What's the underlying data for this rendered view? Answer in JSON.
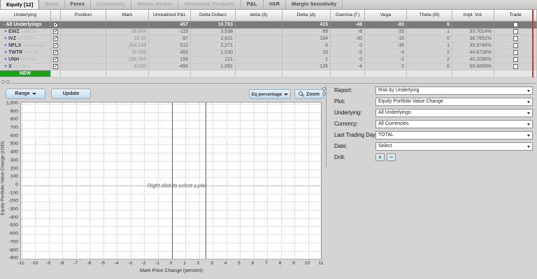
{
  "tabs": [
    {
      "label": "Equity [12]",
      "state": "active"
    },
    {
      "label": "Bond",
      "state": "disabled"
    },
    {
      "label": "Forex",
      "state": "normal"
    },
    {
      "label": "Commodity",
      "state": "disabled"
    },
    {
      "label": "Money Market",
      "state": "disabled"
    },
    {
      "label": "Structured Products",
      "state": "disabled"
    },
    {
      "label": "P&L",
      "state": "normal"
    },
    {
      "label": "VAR",
      "state": "normal"
    },
    {
      "label": "Margin Sensitivity",
      "state": "normal"
    }
  ],
  "table": {
    "columns": [
      "Underlying",
      "",
      "Position",
      "Mark",
      "Unrealized P&L",
      "Delta Dollars",
      "delta (δ)",
      "Delta (Δ)",
      "Gamma (Γ)",
      "Vega",
      "Theta (Θ)",
      "Impl. Vol.",
      "Trade"
    ],
    "total_row": {
      "label": "All Underlyings",
      "collapse_glyph": "-",
      "checked": true,
      "position": "",
      "mark": "",
      "unrealized_pnl": "457",
      "delta_dollars": "10,783",
      "delta_small": "",
      "delta": "415",
      "gamma": "-48",
      "vega": "-83",
      "theta": "6",
      "impl_vol": "",
      "trade_checked": false
    },
    "rows": [
      {
        "expand_glyph": "+",
        "symbol": "EWZ",
        "exchange": "<ARCA>",
        "checked": true,
        "position": "",
        "mark": "39.954",
        "unrealized_pnl": "-119",
        "delta_dollars": "3,538",
        "delta_small": "",
        "delta": "89",
        "gamma": "-8",
        "vega": "-20",
        "theta": "1",
        "impl_vol": "33.7014%",
        "trade_checked": false
      },
      {
        "expand_glyph": "+",
        "symbol": "IVZ",
        "exchange": "<NYSE>",
        "checked": true,
        "position": "",
        "mark": "16.02",
        "unrealized_pnl": "-97",
        "delta_dollars": "2,631",
        "delta_small": "",
        "delta": "164",
        "gamma": "-30",
        "vega": "-16",
        "theta": "0",
        "impl_vol": "38.7651%",
        "trade_checked": false
      },
      {
        "expand_glyph": "+",
        "symbol": "NFLX",
        "exchange": "<NASDAQ>",
        "checked": true,
        "position": "",
        "mark": "364.168",
        "unrealized_pnl": "512",
        "delta_dollars": "2,271",
        "delta_small": "",
        "delta": "6",
        "gamma": "0",
        "vega": "-36",
        "theta": "1",
        "impl_vol": "39.9748%",
        "trade_checked": false
      },
      {
        "expand_glyph": "+",
        "symbol": "TWTR",
        "exchange": "<NYSE>",
        "checked": true,
        "position": "",
        "mark": "35.599",
        "unrealized_pnl": "455",
        "delta_dollars": "1,030",
        "delta_small": "",
        "delta": "29",
        "gamma": "-5",
        "vega": "-9",
        "theta": "2",
        "impl_vol": "44.8738%",
        "trade_checked": false
      },
      {
        "expand_glyph": "+",
        "symbol": "UNH",
        "exchange": "<NYSE>",
        "checked": true,
        "position": "",
        "mark": "266.365",
        "unrealized_pnl": "198",
        "delta_dollars": "221",
        "delta_small": "",
        "delta": "1",
        "gamma": "0",
        "vega": "-2",
        "theta": "2",
        "impl_vol": "40.2098%",
        "trade_checked": false
      },
      {
        "expand_glyph": "+",
        "symbol": "X",
        "exchange": "<NYSE>",
        "checked": true,
        "position": "",
        "mark": "8.636",
        "unrealized_pnl": "-490",
        "delta_dollars": "1,091",
        "delta_small": "",
        "delta": "126",
        "gamma": "-4",
        "vega": "0",
        "theta": "0",
        "impl_vol": "69.6899%",
        "trade_checked": false
      }
    ],
    "new_row_label": "NEW"
  },
  "toolbar": {
    "range_label": "Range",
    "update_label": "Update",
    "eq_percentage_label": "Eq percentage",
    "zoom_label": "Zoom"
  },
  "chart_data": {
    "type": "line",
    "title": "",
    "xlabel": "Mark Price Change (percent)",
    "ylabel": "Equity Portfolio Value Change (USD)",
    "xlim": [
      -11.05,
      11.05
    ],
    "ylim": [
      -915,
      1017
    ],
    "x_ticks": [
      -11,
      -10,
      -9,
      -8,
      -7,
      -6,
      -5,
      -4,
      -3,
      -2,
      -1,
      0,
      1,
      2,
      3,
      4,
      5,
      6,
      7,
      8,
      9,
      10,
      11
    ],
    "y_ticks": [
      1000,
      900,
      800,
      700,
      600,
      500,
      400,
      300,
      200,
      100,
      0,
      -100,
      -200,
      -300,
      -400,
      -500,
      -600,
      -700,
      -800,
      -900
    ],
    "grid": "dotted",
    "legend": "none",
    "series": [],
    "placeholder_text": "Right click to select a plot",
    "reference_lines_x": [
      0,
      2.5
    ],
    "zero_line_y": 0
  },
  "panel": {
    "fields": [
      {
        "label": "Report:",
        "value": "Risk by Underlying"
      },
      {
        "label": "Plot:",
        "value": "Equity Portfolio Value Change"
      },
      {
        "label": "Underlying:",
        "value": "All Underlyings"
      },
      {
        "label": "Currency:",
        "value": "All Currencies"
      },
      {
        "label": "Last Trading Day:",
        "value": "TOTAL"
      },
      {
        "label": "Date:",
        "value": "Select"
      }
    ],
    "drill_label": "Drill:",
    "drill_buttons": [
      {
        "glyph": "+",
        "name": "drill-add-button"
      },
      {
        "glyph": "−",
        "name": "drill-remove-button"
      }
    ]
  }
}
